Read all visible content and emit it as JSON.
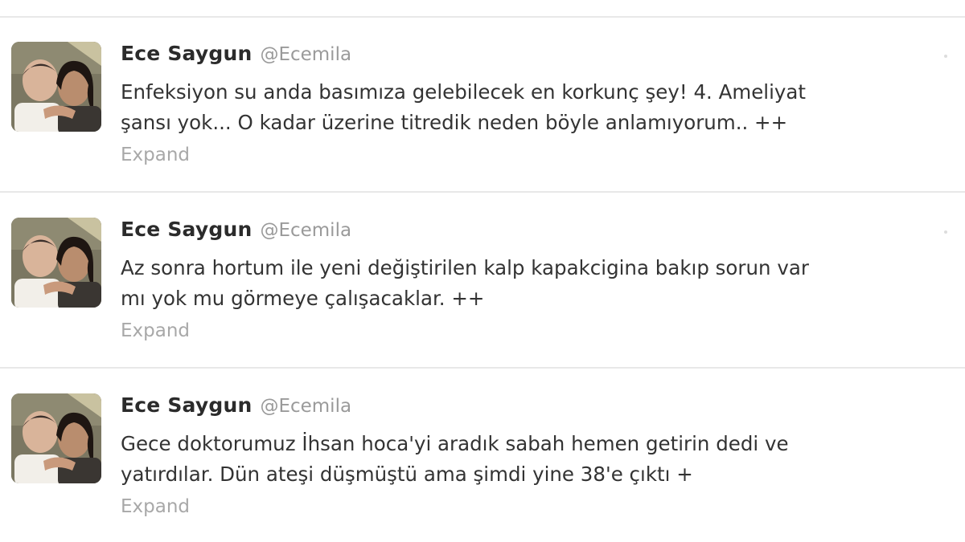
{
  "tweets": [
    {
      "name": "Ece Saygun",
      "handle": "@Ecemila",
      "lines": [
        "Enfeksiyon su anda basımıza gelebilecek en korkunç şey! 4. Ameliyat",
        "şansı yok... O kadar üzerine titredik neden böyle anlamıyorum.. ++"
      ],
      "expand": "Expand"
    },
    {
      "name": "Ece Saygun",
      "handle": "@Ecemila",
      "lines": [
        "Az sonra hortum ile yeni değiştirilen kalp kapakcigina bakıp sorun var",
        "mı yok mu görmeye çalışacaklar. ++"
      ],
      "expand": "Expand"
    },
    {
      "name": "Ece Saygun",
      "handle": "@Ecemila",
      "lines": [
        "Gece doktorumuz İhsan hoca'yi aradık sabah hemen getirin dedi ve",
        "yatırdılar. Dün ateşi düşmüştü ama şimdi yine 38'e çıktı +"
      ],
      "expand": "Expand"
    }
  ]
}
